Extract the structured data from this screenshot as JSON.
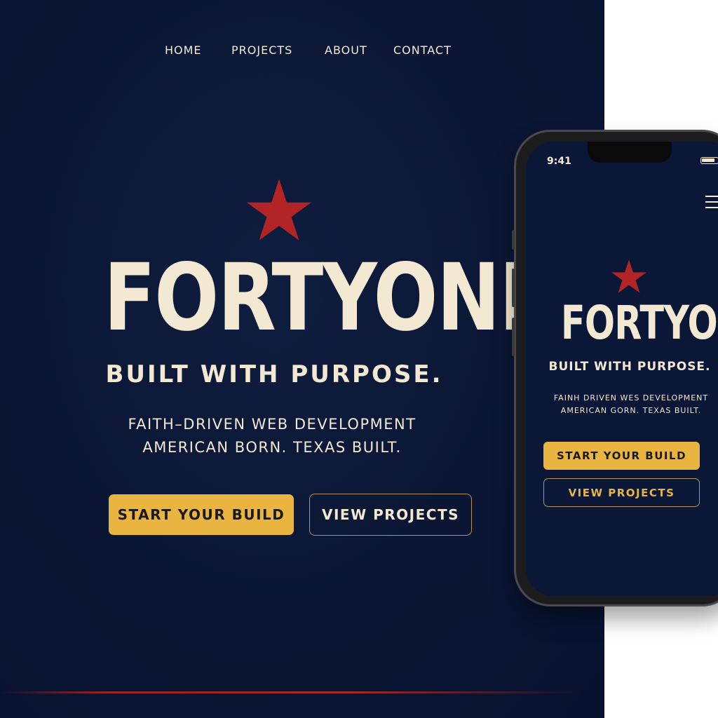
{
  "nav": {
    "items": [
      {
        "label": "HOME"
      },
      {
        "label": "PROJECTS"
      },
      {
        "label": "ABOUT"
      },
      {
        "label": "CONTACT"
      }
    ]
  },
  "hero": {
    "brand": "FORTYONE",
    "tagline": "BUILT WITH PURPOSE.",
    "subline1": "FAITH–DRIVEN WEB DEVELOPMENT",
    "subline2": "AMERICAN BORN. TEXAS BUILT.",
    "primary_cta": "START YOUR BUILD",
    "secondary_cta": "VIEW PROJECTS"
  },
  "phone": {
    "status_time": "9:41",
    "brand": "FORTYONE",
    "tagline": "BUILT WITH PURPOSE.",
    "subline1": "FAINH DRIVEN WES DEVELOPMENT",
    "subline2": "AMERICAN GORN. TEXAS BUILT.",
    "primary_cta": "START YOUR BUILD",
    "secondary_cta": "VIEW PROJECTS"
  },
  "icons": {
    "star": "star-icon",
    "menu": "hamburger-menu-icon",
    "battery": "battery-icon"
  },
  "colors": {
    "background": "#0b1736",
    "accent_gold": "#e9b540",
    "star_red": "#b32426",
    "text_cream": "#f3e8d2",
    "outline_gold": "#b49257"
  }
}
